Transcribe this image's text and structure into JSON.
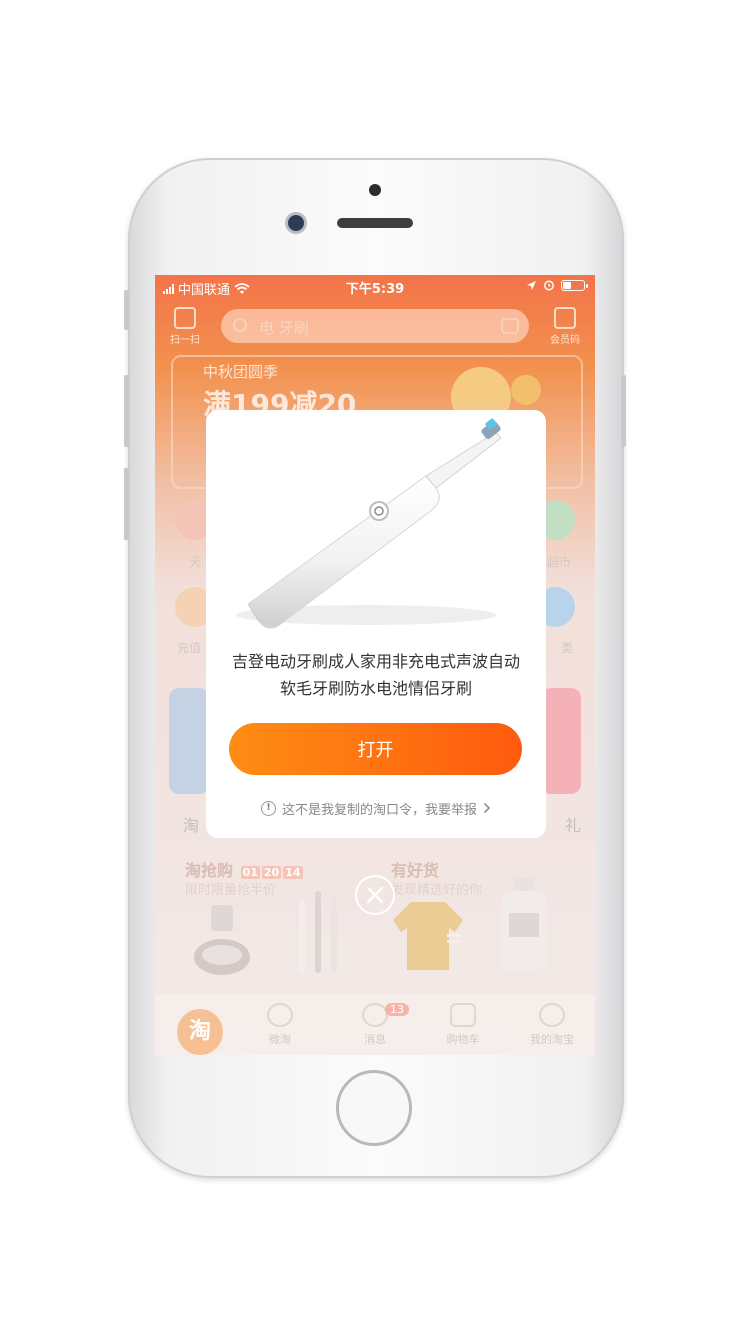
{
  "status_bar": {
    "carrier": "中国联通",
    "time": "下午5:39"
  },
  "app_background": {
    "search_placeholder": "电 牙刷",
    "nav_left_label": "扫一扫",
    "nav_right_label": "会员码",
    "banner_line1": "中秋团圆季",
    "banner_line2": "满199减20",
    "category_left_1": "天",
    "category_right_1": "超市",
    "category_left_2": "充值",
    "category_right_2": "类",
    "feature_left_label": "淘",
    "feature_right_label": "礼",
    "section_left_title": "淘抢购",
    "section_left_timer": [
      "01",
      "20",
      "14"
    ],
    "section_left_sub": "限时限量抢半价",
    "section_right_title": "有好货",
    "section_right_sub": "发现精选好的你",
    "tabs": [
      {
        "label": "淘"
      },
      {
        "label": "微淘"
      },
      {
        "label": "消息"
      },
      {
        "label": "购物车"
      },
      {
        "label": "我的淘宝"
      }
    ],
    "message_badge": "13"
  },
  "dialog": {
    "product_title": "吉登电动牙刷成人家用非充电式声波自动软毛牙刷防水电池情侣牙刷",
    "open_button_label": "打开",
    "report_text": "这不是我复制的淘口令，我要举报",
    "product_image_icon": "electric-toothbrush-image",
    "accent_color_start": "#fe8d14",
    "accent_color_end": "#fe5a0e"
  }
}
